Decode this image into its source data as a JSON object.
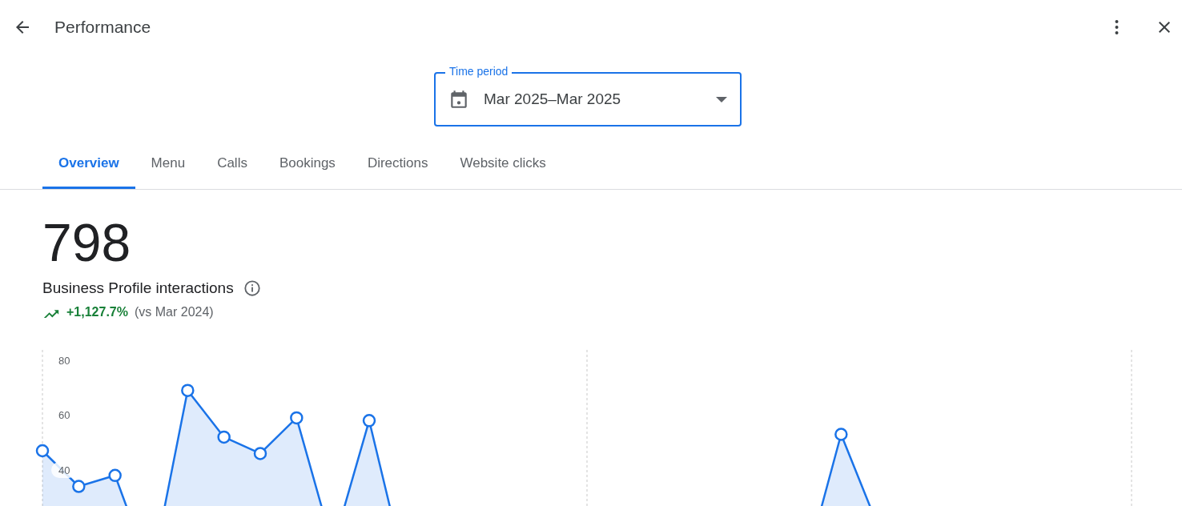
{
  "header": {
    "title": "Performance"
  },
  "time_period": {
    "label": "Time period",
    "value": "Mar 2025–Mar 2025"
  },
  "tabs": [
    {
      "label": "Overview",
      "selected": true
    },
    {
      "label": "Menu",
      "selected": false
    },
    {
      "label": "Calls",
      "selected": false
    },
    {
      "label": "Bookings",
      "selected": false
    },
    {
      "label": "Directions",
      "selected": false
    },
    {
      "label": "Website clicks",
      "selected": false
    }
  ],
  "summary": {
    "value": "798",
    "label": "Business Profile interactions",
    "change": "+1,127.7%",
    "comparison": "(vs Mar 2024)"
  },
  "chart_data": {
    "type": "area",
    "categories": [
      null,
      null,
      null,
      null,
      null,
      null,
      null,
      null,
      null,
      null,
      null,
      null,
      null,
      null,
      null,
      null,
      null,
      null,
      null,
      null,
      null,
      null,
      null,
      null,
      null,
      null,
      null,
      null,
      null,
      null,
      null
    ],
    "series": [
      {
        "color": "#1a73e8",
        "values": [
          47,
          34,
          38,
          2,
          69,
          52,
          46,
          59,
          12,
          58,
          3,
          0,
          0,
          0,
          0,
          0,
          0,
          0,
          0,
          0,
          0,
          4,
          53,
          20,
          0,
          0,
          0,
          0,
          0,
          0,
          0
        ]
      }
    ],
    "ylim": [
      0,
      80
    ],
    "yticks": [
      40,
      60,
      80
    ],
    "grid": true
  }
}
